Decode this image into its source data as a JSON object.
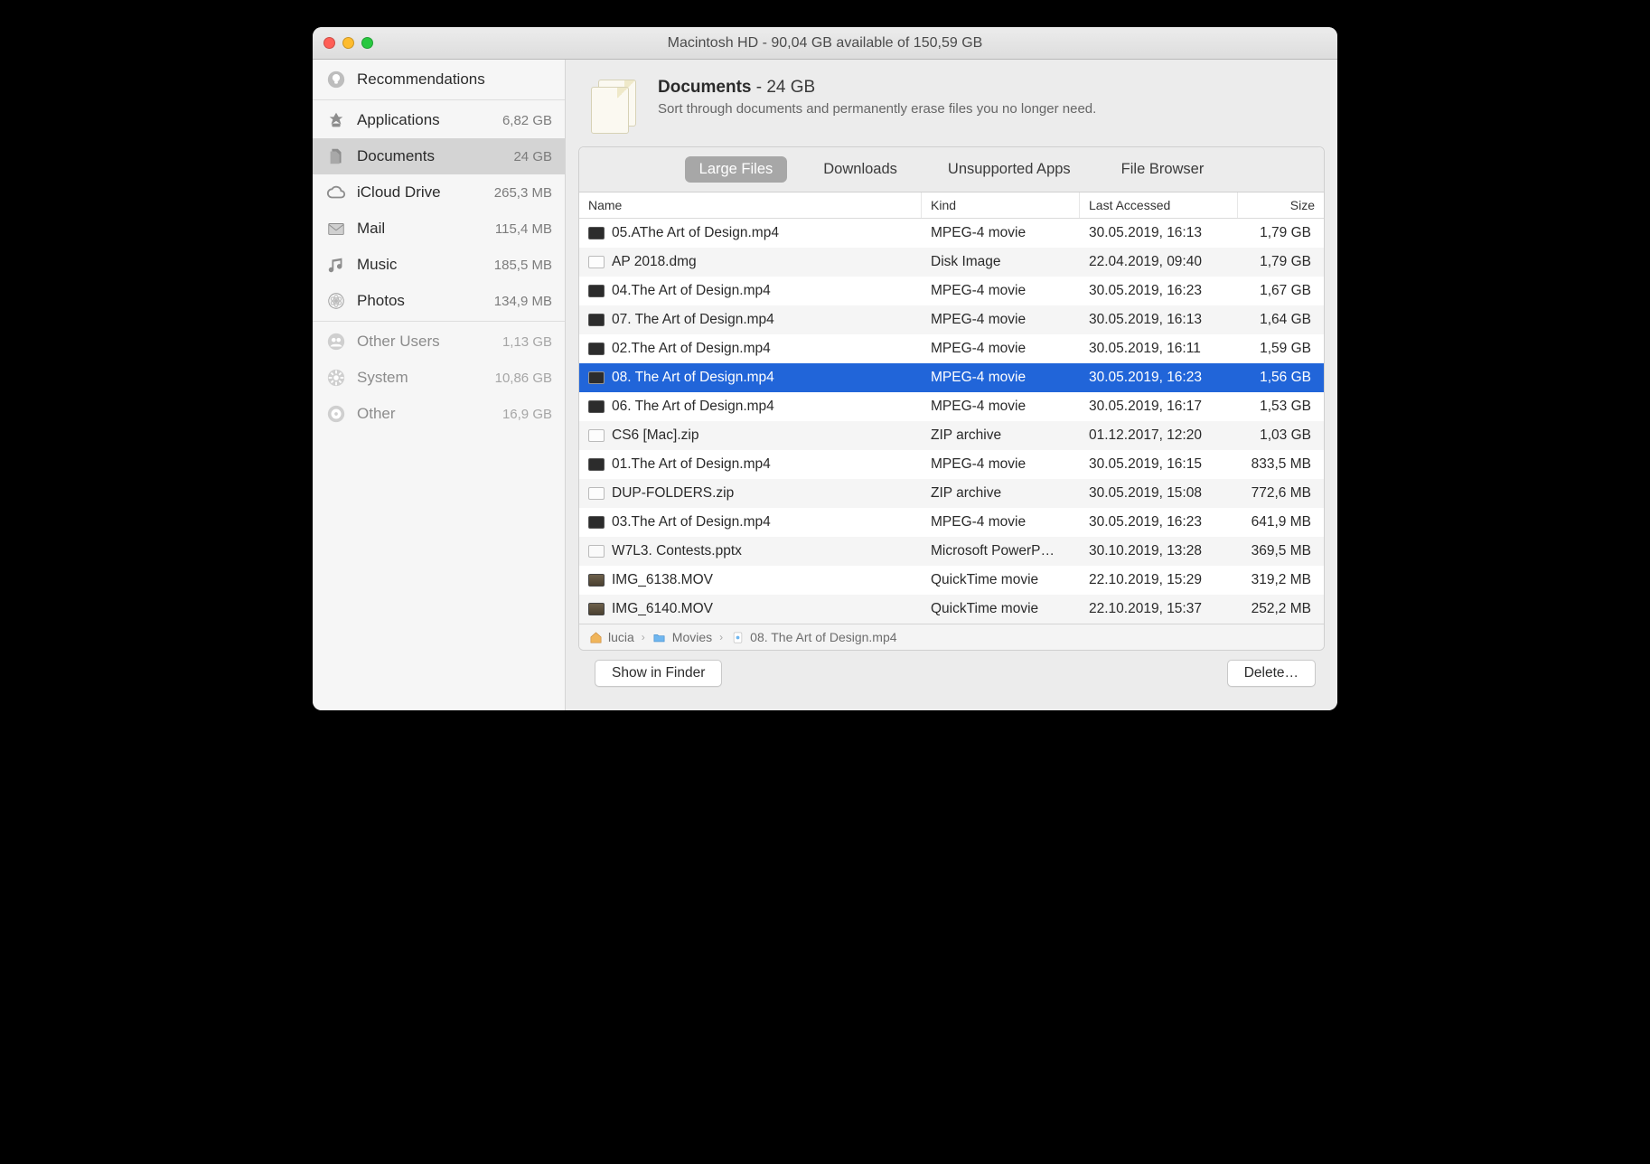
{
  "titlebar": {
    "title": "Macintosh HD - 90,04 GB available of 150,59 GB"
  },
  "sidebar": {
    "items": [
      {
        "icon": "lightbulb-icon",
        "label": "Recommendations",
        "size": "",
        "dim": false
      },
      {
        "icon": "apps-icon",
        "label": "Applications",
        "size": "6,82 GB",
        "dim": false
      },
      {
        "icon": "documents-icon",
        "label": "Documents",
        "size": "24 GB",
        "dim": false,
        "selected": true
      },
      {
        "icon": "cloud-icon",
        "label": "iCloud Drive",
        "size": "265,3 MB",
        "dim": false
      },
      {
        "icon": "mail-icon",
        "label": "Mail",
        "size": "115,4 MB",
        "dim": false
      },
      {
        "icon": "music-icon",
        "label": "Music",
        "size": "185,5 MB",
        "dim": false
      },
      {
        "icon": "photos-icon",
        "label": "Photos",
        "size": "134,9 MB",
        "dim": false
      },
      {
        "icon": "users-icon",
        "label": "Other Users",
        "size": "1,13 GB",
        "dim": true
      },
      {
        "icon": "gear-icon",
        "label": "System",
        "size": "10,86 GB",
        "dim": true
      },
      {
        "icon": "disc-icon",
        "label": "Other",
        "size": "16,9 GB",
        "dim": true
      }
    ]
  },
  "panel": {
    "title_strong": "Documents",
    "title_sep": " - ",
    "title_size": "24 GB",
    "description": "Sort through documents and permanently erase files you no longer need."
  },
  "tabs": {
    "items": [
      {
        "label": "Large Files",
        "active": true
      },
      {
        "label": "Downloads",
        "active": false
      },
      {
        "label": "Unsupported Apps",
        "active": false
      },
      {
        "label": "File Browser",
        "active": false
      }
    ]
  },
  "columns": {
    "name": "Name",
    "kind": "Kind",
    "last": "Last Accessed",
    "size": "Size"
  },
  "files": [
    {
      "thumb": "mp4",
      "name": "05.AThe Art of Design.mp4",
      "kind": "MPEG-4 movie",
      "last": "30.05.2019, 16:13",
      "size": "1,79 GB"
    },
    {
      "thumb": "dmg",
      "name": "AP 2018.dmg",
      "kind": "Disk Image",
      "last": "22.04.2019, 09:40",
      "size": "1,79 GB"
    },
    {
      "thumb": "mp4",
      "name": "04.The Art of Design.mp4",
      "kind": "MPEG-4 movie",
      "last": "30.05.2019, 16:23",
      "size": "1,67 GB"
    },
    {
      "thumb": "mp4",
      "name": "07. The Art of Design.mp4",
      "kind": "MPEG-4 movie",
      "last": "30.05.2019, 16:13",
      "size": "1,64 GB"
    },
    {
      "thumb": "mp4",
      "name": "02.The Art of Design.mp4",
      "kind": "MPEG-4 movie",
      "last": "30.05.2019, 16:11",
      "size": "1,59 GB"
    },
    {
      "thumb": "mp4",
      "name": "08. The Art of Design.mp4",
      "kind": "MPEG-4 movie",
      "last": "30.05.2019, 16:23",
      "size": "1,56 GB",
      "selected": true
    },
    {
      "thumb": "mp4",
      "name": "06. The Art of Design.mp4",
      "kind": "MPEG-4 movie",
      "last": "30.05.2019, 16:17",
      "size": "1,53 GB"
    },
    {
      "thumb": "zip",
      "name": "CS6 [Mac].zip",
      "kind": "ZIP archive",
      "last": "01.12.2017, 12:20",
      "size": "1,03 GB"
    },
    {
      "thumb": "mp4",
      "name": "01.The Art of Design.mp4",
      "kind": "MPEG-4 movie",
      "last": "30.05.2019, 16:15",
      "size": "833,5 MB"
    },
    {
      "thumb": "zip",
      "name": "DUP-FOLDERS.zip",
      "kind": "ZIP archive",
      "last": "30.05.2019, 15:08",
      "size": "772,6 MB"
    },
    {
      "thumb": "mp4",
      "name": "03.The Art of Design.mp4",
      "kind": "MPEG-4 movie",
      "last": "30.05.2019, 16:23",
      "size": "641,9 MB"
    },
    {
      "thumb": "ppt",
      "name": "W7L3. Contests.pptx",
      "kind": "Microsoft PowerP…",
      "last": "30.10.2019, 13:28",
      "size": "369,5 MB"
    },
    {
      "thumb": "mov",
      "name": "IMG_6138.MOV",
      "kind": "QuickTime movie",
      "last": "22.10.2019, 15:29",
      "size": "319,2 MB"
    },
    {
      "thumb": "mov",
      "name": "IMG_6140.MOV",
      "kind": "QuickTime movie",
      "last": "22.10.2019, 15:37",
      "size": "252,2 MB"
    }
  ],
  "path": {
    "segments": [
      {
        "icon": "home-icon",
        "label": "lucia"
      },
      {
        "icon": "folder-icon",
        "label": "Movies"
      },
      {
        "icon": "file-icon",
        "label": "08. The Art of Design.mp4"
      }
    ]
  },
  "footer": {
    "show_in_finder": "Show in Finder",
    "delete": "Delete…"
  }
}
